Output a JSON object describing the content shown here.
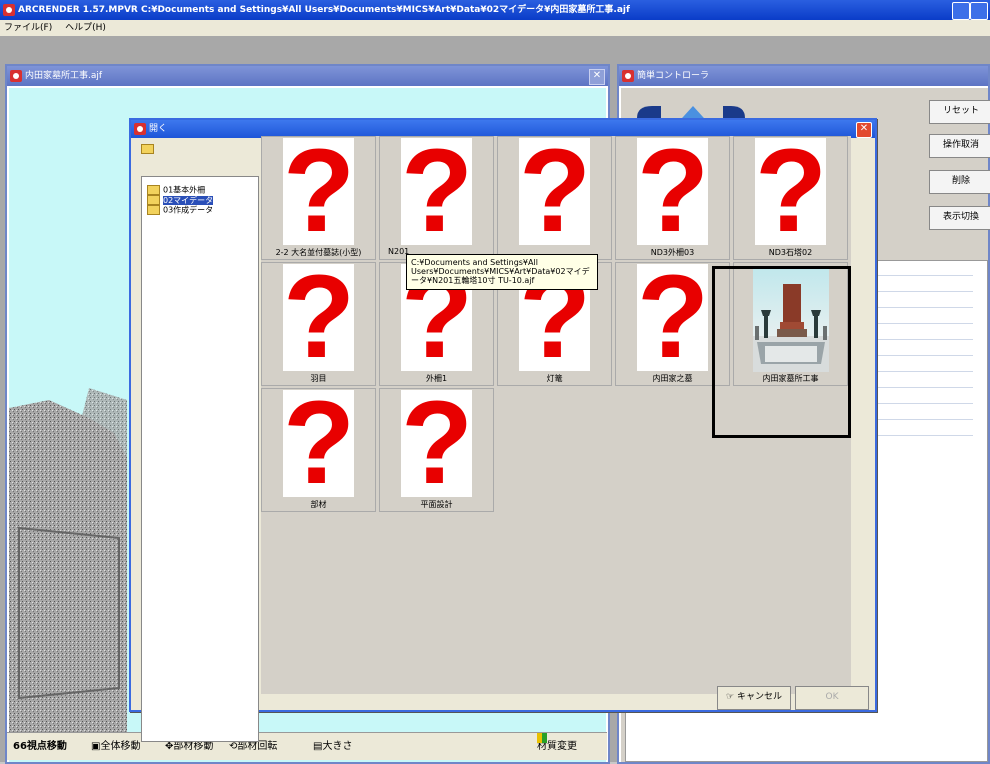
{
  "app": {
    "title": "ARCRENDER 1.57.MPVR   C:¥Documents and Settings¥All Users¥Documents¥MICS¥Art¥Data¥02マイデータ¥内田家墓所工事.ajf",
    "menu": [
      "ファイル(F)",
      "ヘルプ(H)"
    ]
  },
  "viewport": {
    "title": "内田家墓所工事.ajf",
    "bottom_buttons": [
      "視点移動",
      "全体移動",
      "部材移動",
      "部材回転",
      "大きさ",
      "材質変更"
    ]
  },
  "controller": {
    "title": "簡単コントローラ",
    "buttons": [
      "リセット",
      "操作取消",
      "削除",
      "表示切換"
    ]
  },
  "dialog": {
    "title": "開く",
    "tree": [
      {
        "label": "01基本外柵",
        "selected": false
      },
      {
        "label": "02マイデータ",
        "selected": true
      },
      {
        "label": "03作成データ",
        "selected": false
      }
    ],
    "items": [
      {
        "label": "2-2 大名並付墓誌(小型)",
        "has_preview": false
      },
      {
        "label": "N201",
        "has_preview": false
      },
      {
        "label": "",
        "has_preview": false
      },
      {
        "label": "ND3外柵03",
        "has_preview": false
      },
      {
        "label": "ND3石塔02",
        "has_preview": false
      },
      {
        "label": "羽目",
        "has_preview": false
      },
      {
        "label": "外柵1",
        "has_preview": false
      },
      {
        "label": "灯篭",
        "has_preview": false
      },
      {
        "label": "内田家之墓",
        "has_preview": false
      },
      {
        "label": "内田家墓所工事",
        "has_preview": true
      },
      {
        "label": "部材",
        "has_preview": false
      },
      {
        "label": "平面設計",
        "has_preview": false
      }
    ],
    "tooltip": "C:¥Documents and Settings¥All Users¥Documents¥MICS¥Art¥Data¥02マイデータ¥N201五輪塔10寸 TU-10.ajf",
    "cancel_label": "キャンセル",
    "ok_label": "OK"
  },
  "colors": {
    "title_bar": "#0a3cc8",
    "question_mark": "#e80000",
    "viewport_bg": "#c8f8f8"
  }
}
